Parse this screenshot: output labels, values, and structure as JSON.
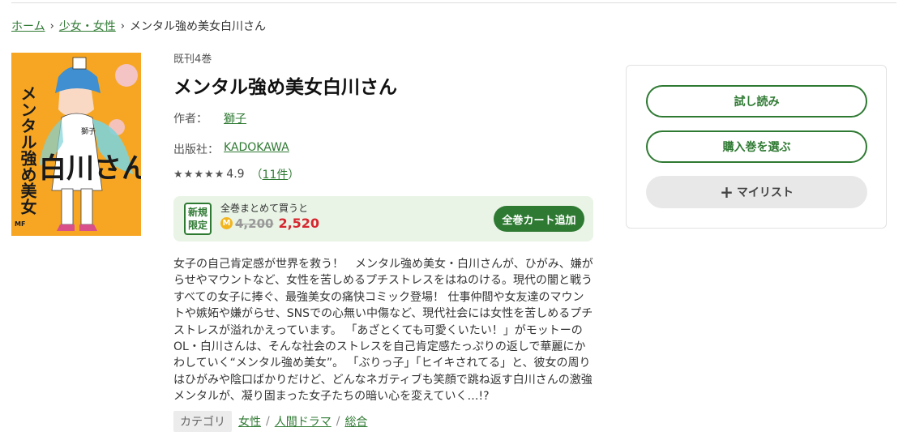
{
  "breadcrumb": {
    "home": "ホーム",
    "category": "少女・女性",
    "current": "メンタル強め美女白川さん",
    "separator": "›"
  },
  "cover": {
    "alt": "メンタル強め美女白川さん cover",
    "title_vertical": "メンタル強め美女",
    "title_large": "白川さん",
    "author": "獅子",
    "publisher_mark": "MF"
  },
  "book": {
    "volumes": "既刊4巻",
    "title": "メンタル強め美女白川さん",
    "author_label": "作者：",
    "author": "獅子",
    "publisher_label": "出版社：",
    "publisher": "KADOKAWA",
    "rating": "4.9",
    "rating_count_open": "（",
    "rating_count": "11件",
    "rating_count_close": "）",
    "rating_stars": 5
  },
  "promo": {
    "badge_line1": "新規",
    "badge_line2": "限定",
    "text": "全巻まとめて買うと",
    "coin": "M",
    "old_price": "4,200",
    "new_price": "2,520",
    "cart_button": "全巻カート追加"
  },
  "description": "女子の自己肯定感が世界を救う！　メンタル強め美女・白川さんが、ひがみ、嫌がらせやマウントなど、女性を苦しめるプチストレスをはねのける。現代の闇と戦うすべての女子に捧ぐ、最強美女の痛快コミック登場！ 仕事仲間や女友達のマウントや嫉妬や嫌がらせ、SNSでの心無い中傷など、現代社会には女性を苦しめるプチストレスが溢れかえっています。 「あざとくても可愛くいたい！」がモットーのOL・白川さんは、そんな社会のストレスを自己肯定感たっぷりの返しで華麗にかわしていく“メンタル強め美女”。 「ぶりっ子」「ヒイキされてる」と、彼女の周りはひがみや陰口ばかりだけど、どんなネガティブも笑顔で跳ね返す白川さんの激強メンタルが、凝り固まった女子たちの暗い心を変えていく…!?",
  "categories": {
    "label": "カテゴリ",
    "items": [
      "女性",
      "人間ドラマ",
      "総合"
    ],
    "separator": "/"
  },
  "actions": {
    "trial": "試し読み",
    "choose_volume": "購入巻を選ぶ",
    "mylist": "マイリスト",
    "mylist_icon": "+"
  },
  "colors": {
    "accent": "#2f7a33",
    "price": "#d7262f",
    "promo_bg": "#e9f4e6",
    "cover_bg": "#f6a623"
  }
}
